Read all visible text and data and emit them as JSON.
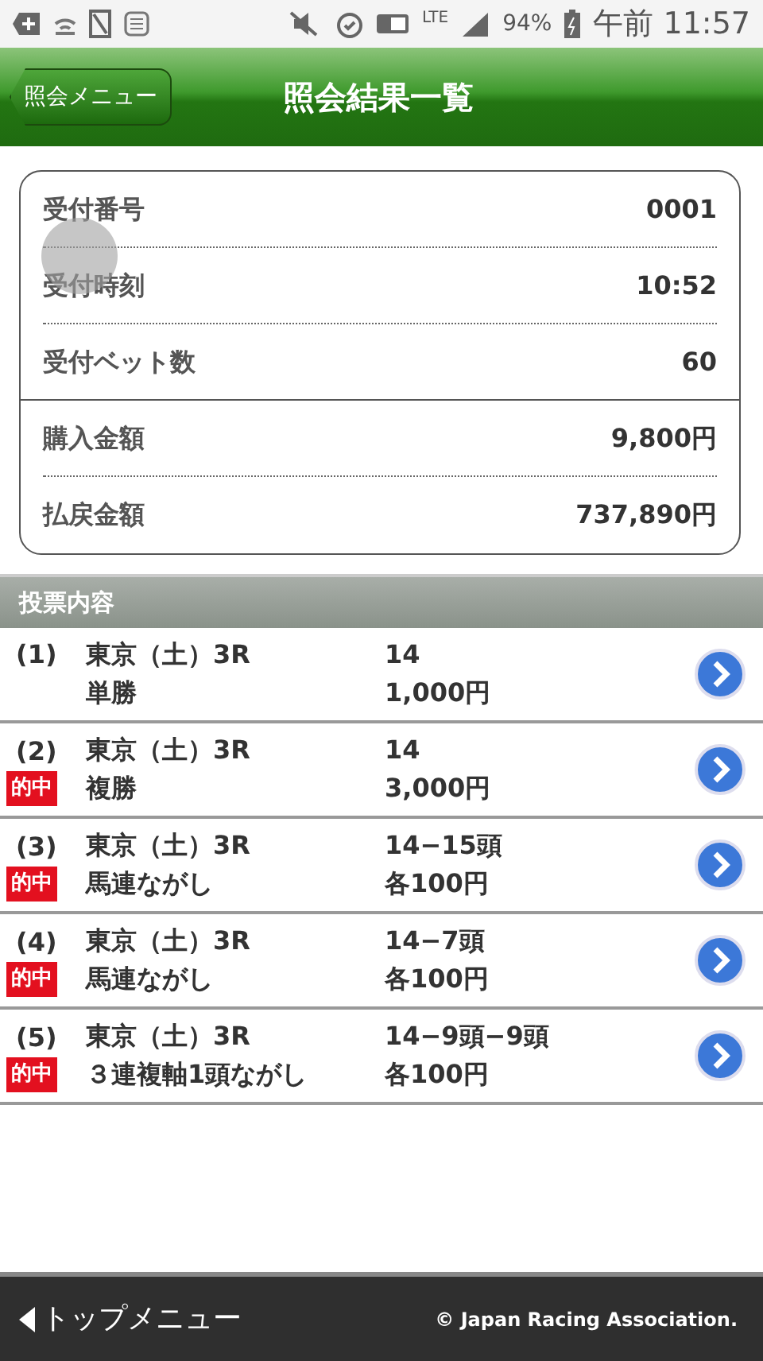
{
  "status_bar": {
    "network": "LTE",
    "battery": "94%",
    "time": "午前 11:57"
  },
  "header": {
    "back_button": "照会メニュー",
    "title": "照会結果一覧"
  },
  "summary": [
    [
      {
        "label": "受付番号",
        "value": "0001"
      },
      {
        "label": "受付時刻",
        "value": "10:52"
      },
      {
        "label": "受付ベット数",
        "value": "60"
      }
    ],
    [
      {
        "label": "購入金額",
        "value": "9,800円"
      },
      {
        "label": "払戻金額",
        "value": "737,890円"
      }
    ]
  ],
  "section_title": "投票内容",
  "bets": [
    {
      "number": "(1)",
      "race": "東京（土）3R",
      "type": "単勝",
      "selection": "14",
      "amount": "1,000円"
    },
    {
      "number": "(2)",
      "hit_label": "的中",
      "race": "東京（土）3R",
      "type": "複勝",
      "selection": "14",
      "amount": "3,000円"
    },
    {
      "number": "(3)",
      "hit_label": "的中",
      "race": "東京（土）3R",
      "type": "馬連ながし",
      "selection": "14−15頭",
      "amount": "各100円"
    },
    {
      "number": "(4)",
      "hit_label": "的中",
      "race": "東京（土）3R",
      "type": "馬連ながし",
      "selection": "14−7頭",
      "amount": "各100円"
    },
    {
      "number": "(5)",
      "hit_label": "的中",
      "race": "東京（土）3R",
      "type": "３連複軸1頭ながし",
      "selection": "14−9頭−9頭",
      "amount": "各100円"
    }
  ],
  "footer": {
    "top_menu": "トップメニュー",
    "copyright": "© Japan Racing Association."
  }
}
